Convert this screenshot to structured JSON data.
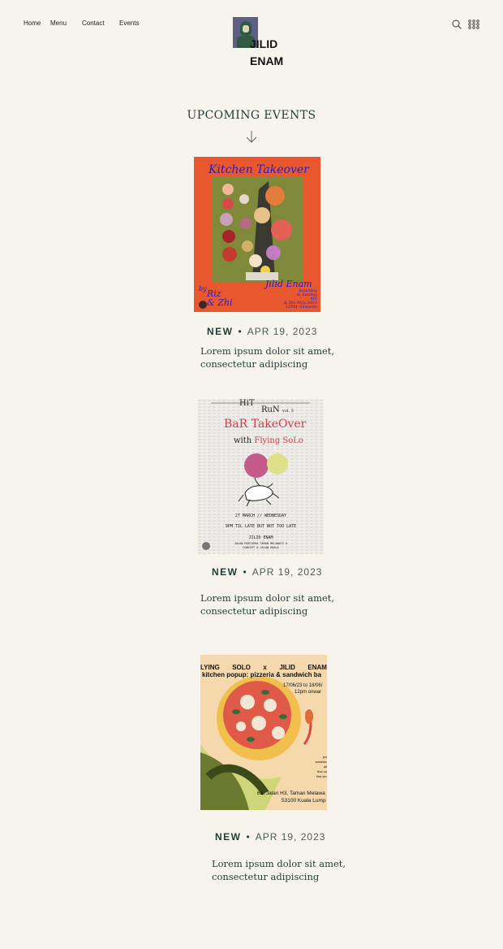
{
  "nav": {
    "home": "Home",
    "menu": "Menu",
    "contact": "Contact",
    "events": "Events"
  },
  "brand": {
    "line1": "JILID",
    "line2": "ENAM"
  },
  "icons": {
    "search": "search-icon",
    "menu_grid": "grid-menu-icon",
    "arrow": "arrow-down-icon"
  },
  "section": {
    "title": "UPCOMING EVENTS"
  },
  "events": [
    {
      "badge": "NEW",
      "date": "APR 19, 2023",
      "description": "Lorem ipsum dolor sit amet, consectetur adipiscing",
      "poster": {
        "title": "Kitchen Takeover",
        "by": "by",
        "chefs_line1": "Riz",
        "chefs_line2": "& Zhi",
        "venue": "Jilid Enam",
        "detail1": "Saturday",
        "detail2": "& Sunday",
        "detail3": "4th",
        "detail4": "& 5th May 2023",
        "detail5": "12PM Onwards"
      }
    },
    {
      "badge": "NEW",
      "date": "APR 19, 2023",
      "description": "Lorem ipsum dolor sit amet, consectetur adipiscing",
      "poster": {
        "series": "HiT",
        "series2": "RuN",
        "vol": "vol. 3",
        "title": "BaR TakeOver",
        "with": "with",
        "guest": "Flying SoLo",
        "date_line": "27 MARCH // WEDNESDAY",
        "time_line": "9PM TIL LATE BUT NOT TOO LATE",
        "venue": "JILID ENAM",
        "address1": "JALAN MUSTAPHA TAMAN MELAWATI &",
        "address2": "CONCEPT & JALAN KUALA"
      }
    },
    {
      "badge": "NEW",
      "date": "APR 19, 2023",
      "description": "Lorem ipsum dolor sit amet, consectetur adipiscing",
      "poster": {
        "w1": "LYING",
        "w2": "SOLO",
        "w3": "x",
        "w4": "JILID",
        "w5": "ENAM",
        "subtitle": "kitchen popup: pizzeria & sandwich ba",
        "dates": "17/06/23 to 18/06/",
        "time": "12pm onwar",
        "side1": "piz",
        "side2": "sandwic",
        "side3": "all",
        "side4": "first co",
        "side5": "first ser",
        "address1": "6a, Jalan H3, Taman Melawa",
        "address2": "53100 Kuala Lump"
      }
    }
  ]
}
